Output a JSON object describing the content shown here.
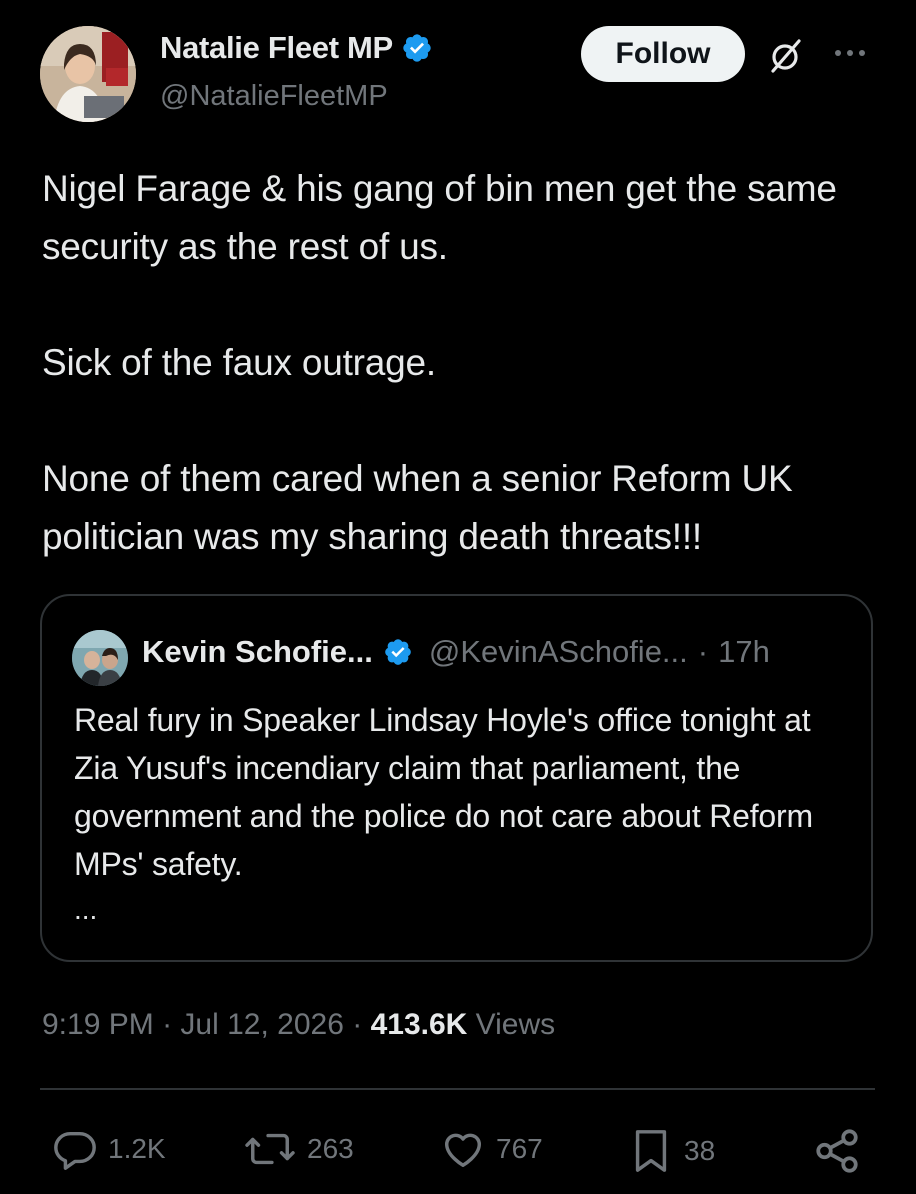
{
  "author": {
    "display_name": "Natalie Fleet MP",
    "handle": "@NatalieFleetMP",
    "verified": true,
    "avatar_icon": "profile-photo"
  },
  "header": {
    "follow_label": "Follow",
    "grok_icon": "grok-icon",
    "more_icon": "more-icon"
  },
  "post": {
    "text": "Nigel Farage & his gang of bin men get the same security as the rest of us.\n\nSick of the faux outrage.\n\nNone of them cared when a senior Reform UK politician was my sharing death threats!!!"
  },
  "quoted_post": {
    "display_name": "Kevin Schofie...",
    "handle": "@KevinASchofie...",
    "separator": "·",
    "time": "17h",
    "verified": true,
    "text": "Real fury in Speaker Lindsay Hoyle's office tonight at Zia Yusuf's incendiary claim that parliament, the government and the police do not care about Reform MPs' safety.",
    "ellipsis": "..."
  },
  "meta": {
    "time": "9:19 PM",
    "sep1": "·",
    "date": "Jul 12, 2026",
    "sep2": "·",
    "views_count": "413.6K",
    "views_label": "Views"
  },
  "actions": {
    "replies": "1.2K",
    "reposts": "263",
    "likes": "767",
    "bookmarks": "38"
  },
  "colors": {
    "background": "#000000",
    "text": "#e7e9ea",
    "secondary": "#71767b",
    "verified": "#1d9bf0",
    "border": "#2f3336"
  }
}
